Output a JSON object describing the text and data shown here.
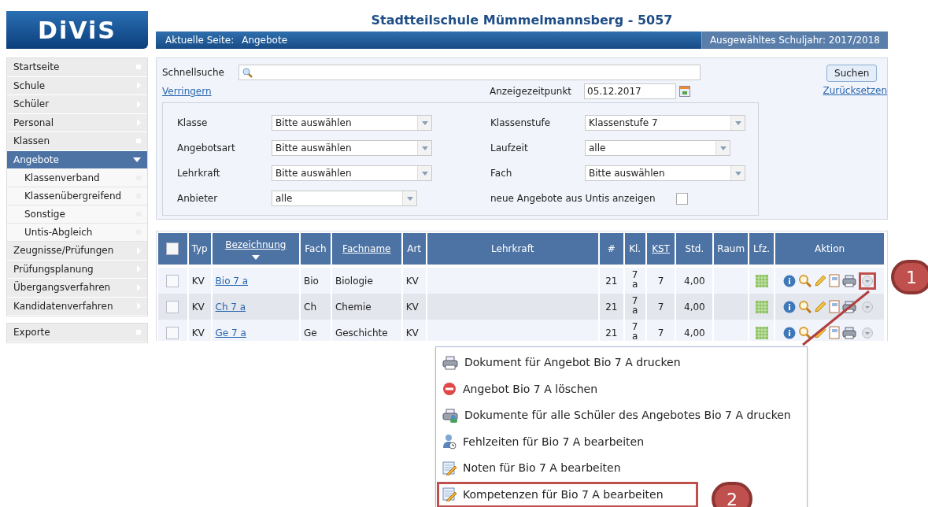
{
  "logo": {
    "text": "DiViS"
  },
  "header": {
    "title": "Stadtteilschule Mümmelmannsberg - 5057",
    "current_page_label": "Aktuelle Seite:",
    "current_page": "Angebote",
    "school_year": "Ausgewähltes Schuljahr: 2017/2018"
  },
  "sidebar": {
    "items": [
      {
        "label": "Startseite",
        "kind": "square",
        "selected": false
      },
      {
        "label": "Schule",
        "kind": "arrow",
        "selected": false
      },
      {
        "label": "Schüler",
        "kind": "arrow",
        "selected": false
      },
      {
        "label": "Personal",
        "kind": "arrow",
        "selected": false
      },
      {
        "label": "Klassen",
        "kind": "square",
        "selected": false
      },
      {
        "label": "Angebote",
        "kind": "down",
        "selected": true,
        "children": [
          {
            "label": "Klassenverband",
            "selected": false
          },
          {
            "label": "Klassenübergreifend",
            "selected": false
          },
          {
            "label": "Sonstige",
            "selected": false
          },
          {
            "label": "Untis-Abgleich",
            "selected": false
          }
        ]
      },
      {
        "label": "Zeugnisse/Prüfungen",
        "kind": "arrow",
        "selected": false
      },
      {
        "label": "Prüfungsplanung",
        "kind": "arrow",
        "selected": false
      },
      {
        "label": "Übergangsverfahren",
        "kind": "arrow",
        "selected": false
      },
      {
        "label": "Kandidatenverfahren",
        "kind": "arrow",
        "selected": false
      }
    ],
    "extra_items": [
      {
        "label": "Exporte",
        "kind": "square",
        "selected": false
      }
    ]
  },
  "filter": {
    "quick_search_label": "Schnellsuche",
    "reduce_link": "Verringern",
    "date_label": "Anzeigezeitpunkt",
    "date_value": "05.12.2017",
    "search_button": "Suchen",
    "reset_link": "Zurücksetzen",
    "left_fields": [
      {
        "label": "Klasse",
        "value": "Bitte auswählen",
        "kind": "select"
      },
      {
        "label": "Angebotsart",
        "value": "Bitte auswählen",
        "kind": "select"
      },
      {
        "label": "Lehrkraft",
        "value": "Bitte auswählen",
        "kind": "select"
      },
      {
        "label": "Anbieter",
        "value": "alle",
        "kind": "select-short"
      }
    ],
    "right_fields": [
      {
        "label": "Klassenstufe",
        "value": "Klassenstufe 7",
        "kind": "select"
      },
      {
        "label": "Laufzeit",
        "value": "alle",
        "kind": "select-short"
      },
      {
        "label": "Fach",
        "value": "Bitte auswählen",
        "kind": "select"
      },
      {
        "label": "neue Angebote aus Untis anzeigen",
        "kind": "checkbox",
        "checked": false
      }
    ]
  },
  "table": {
    "select_all_checked": false,
    "columns": [
      {
        "label": "Typ",
        "sortable": false,
        "sorted": false
      },
      {
        "label": "Bezeichnung",
        "sortable": true,
        "sorted": true
      },
      {
        "label": "Fach",
        "sortable": false,
        "sorted": false
      },
      {
        "label": "Fachname",
        "sortable": true,
        "sorted": false
      },
      {
        "label": "Art",
        "sortable": false,
        "sorted": false
      },
      {
        "label": "Lehrkraft",
        "sortable": false,
        "sorted": false
      },
      {
        "label": "#",
        "sortable": false,
        "sorted": false
      },
      {
        "label": "Kl.",
        "sortable": false,
        "sorted": false
      },
      {
        "label": "KST",
        "sortable": true,
        "sorted": false
      },
      {
        "label": "Std.",
        "sortable": false,
        "sorted": false
      },
      {
        "label": "Raum",
        "sortable": false,
        "sorted": false
      },
      {
        "label": "Lfz.",
        "sortable": false,
        "sorted": false
      },
      {
        "label": "Aktion",
        "sortable": false,
        "sorted": false
      }
    ],
    "rows": [
      {
        "checked": false,
        "typ": "KV",
        "bezeichnung": "Bio 7 a",
        "fach": "Bio",
        "fachname": "Biologie",
        "art": "KV",
        "count": "21",
        "klasse": "7 a",
        "kst": "7",
        "std": "4,00",
        "menu_open": true
      },
      {
        "checked": false,
        "typ": "KV",
        "bezeichnung": "Ch 7 a",
        "fach": "Ch",
        "fachname": "Chemie",
        "art": "KV",
        "count": "21",
        "klasse": "7 a",
        "kst": "7",
        "std": "4,00",
        "menu_open": false
      },
      {
        "checked": false,
        "typ": "KV",
        "bezeichnung": "Ge 7 a",
        "fach": "Ge",
        "fachname": "Geschichte",
        "art": "KV",
        "count": "21",
        "klasse": "7 a",
        "kst": "7",
        "std": "4,00",
        "menu_open": false
      }
    ]
  },
  "context_menu": {
    "items": [
      {
        "label": "Dokument für Angebot Bio 7 A drucken",
        "kind": "print",
        "selected": false
      },
      {
        "label": "Angebot Bio 7 A löschen",
        "kind": "delete",
        "selected": false
      },
      {
        "label": "Dokumente für alle Schüler des Angebotes Bio 7 A drucken",
        "kind": "print-all",
        "selected": false
      },
      {
        "label": "Fehlzeiten für Bio 7 A bearbeiten",
        "kind": "absence",
        "selected": false
      },
      {
        "label": "Noten für Bio 7 A bearbeiten",
        "kind": "grades",
        "selected": false
      },
      {
        "label": "Kompetenzen für Bio 7 A bearbeiten",
        "kind": "grades",
        "selected": true
      }
    ]
  },
  "callouts": [
    {
      "label": "1"
    },
    {
      "label": "2"
    }
  ]
}
